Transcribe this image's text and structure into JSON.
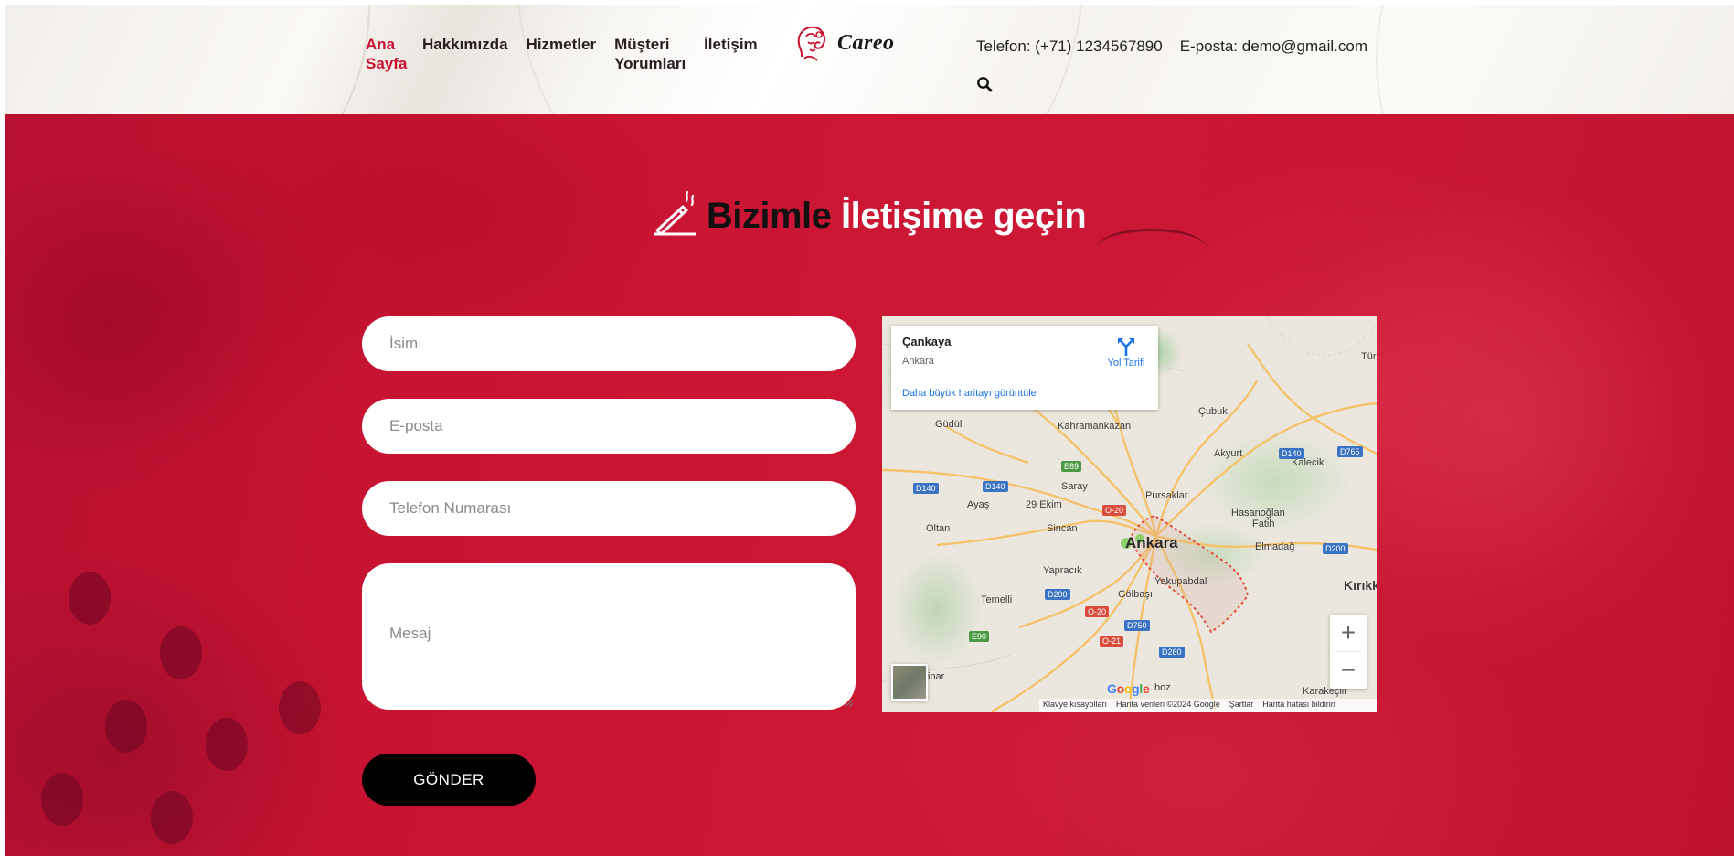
{
  "header": {
    "nav": [
      {
        "label": "Ana Sayfa",
        "active": true
      },
      {
        "label": "Hakkımızda",
        "active": false
      },
      {
        "label": "Hizmetler",
        "active": false
      },
      {
        "label": "Müşteri Yorumları",
        "active": false
      },
      {
        "label": "İletişim",
        "active": false
      }
    ],
    "logo_text": "Careo",
    "phone": "Telefon: (+71) 1234567890",
    "email": "E-posta: demo@gmail.com",
    "search_icon": "search-icon"
  },
  "contact": {
    "title_dark": "Bizimle",
    "title_light": "İletişime geçin",
    "title_icon": "writing-pen-icon",
    "form": {
      "name_placeholder": "İsim",
      "email_placeholder": "E-posta",
      "phone_placeholder": "Telefon Numarası",
      "message_placeholder": "Mesaj",
      "submit_label": "GÖNDER"
    }
  },
  "map": {
    "place_name": "Çankaya",
    "place_sub": "Ankara",
    "directions_label": "Yol Tarifi",
    "larger_map": "Daha büyük haritayı görüntüle",
    "labels": [
      "Güdül",
      "Kahramankazan",
      "Çubuk",
      "Akyurt",
      "Kalecik",
      "Saray",
      "Ayaş",
      "29 Ekim",
      "Pursaklar",
      "Hasanoğlan",
      "Fatih",
      "Elmadağ",
      "Oltan",
      "Sincan",
      "Yapracık",
      "Yakupabdal",
      "Gölbaşı",
      "Temelli",
      "Kırıkk",
      "Karakeçili",
      "Tür",
      "boz",
      "inar"
    ],
    "city": "Ankara",
    "roads": [
      "D140",
      "D140",
      "E89",
      "O-20",
      "D140",
      "D765",
      "D200",
      "D200",
      "O-20",
      "D750",
      "E90",
      "O-21",
      "D260"
    ],
    "zoom_in": "+",
    "zoom_out": "−",
    "google": "Google",
    "footer": {
      "shortcuts": "Klavye kısayolları",
      "data": "Harita verileri ©2024 Google",
      "terms": "Şartlar",
      "report": "Harita hatası bildirin"
    }
  },
  "colors": {
    "accent_red": "#c8102e",
    "hero_red": "#c81432",
    "button_black": "#000000",
    "map_link_blue": "#1a73e8"
  }
}
